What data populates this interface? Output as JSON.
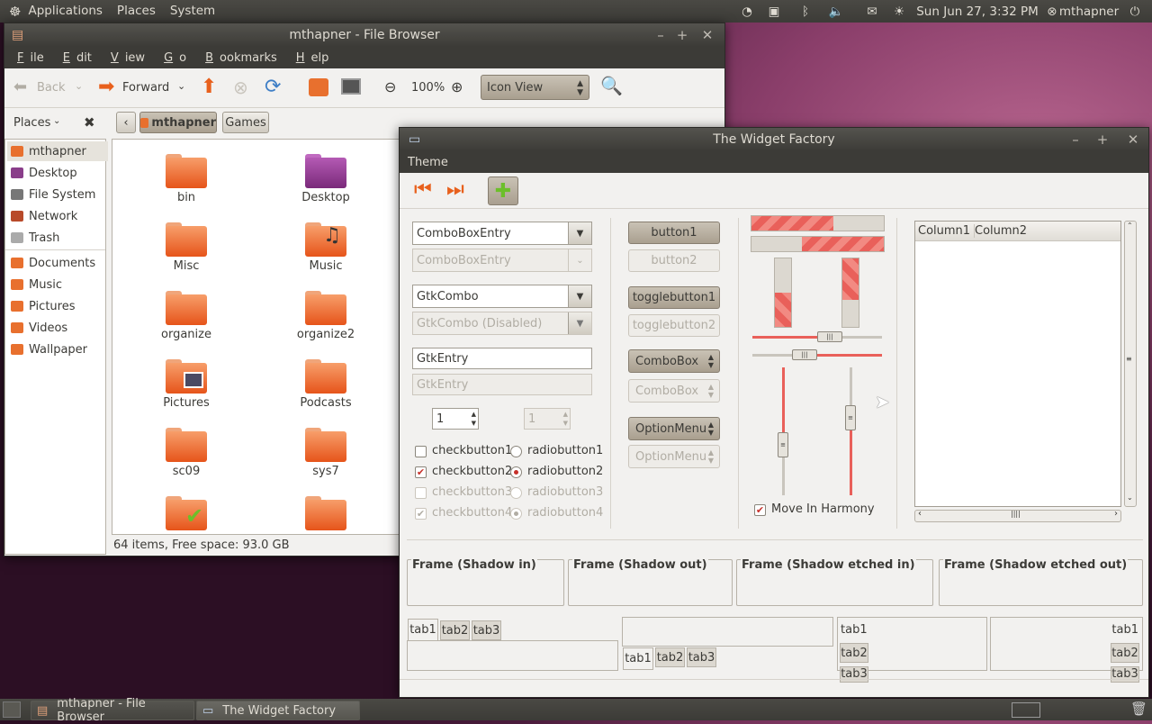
{
  "top_panel": {
    "menus": [
      "Applications",
      "Places",
      "System"
    ],
    "clock": "Sun Jun 27,  3:32 PM",
    "user": "mthapner"
  },
  "file_browser": {
    "title": "mthapner - File Browser",
    "menus": [
      {
        "label": "File",
        "key": "F"
      },
      {
        "label": "Edit",
        "key": "E"
      },
      {
        "label": "View",
        "key": "V"
      },
      {
        "label": "Go",
        "key": "G"
      },
      {
        "label": "Bookmarks",
        "key": "B"
      },
      {
        "label": "Help",
        "key": "H"
      }
    ],
    "toolbar": {
      "back": "Back",
      "forward": "Forward",
      "zoom": "100%",
      "view_mode": "Icon View"
    },
    "places_label": "Places",
    "path": [
      "mthapner",
      "Games"
    ],
    "sidebar": [
      "mthapner",
      "Desktop",
      "File System",
      "Network",
      "Trash",
      "Documents",
      "Music",
      "Pictures",
      "Videos",
      "Wallpaper"
    ],
    "files": [
      "bin",
      "Desktop",
      "Misc",
      "Music",
      "organize",
      "organize2",
      "Pictures",
      "Podcasts",
      "sc09",
      "sys7",
      "",
      ""
    ],
    "status": "64 items, Free space: 93.0 GB"
  },
  "widget_factory": {
    "title": "The Widget Factory",
    "menu": "Theme",
    "combo_entry": "ComboBoxEntry",
    "combo_entry_dis": "ComboBoxEntry",
    "gtk_combo": "GtkCombo",
    "gtk_combo_dis": "GtkCombo (Disabled)",
    "gtk_entry": "GtkEntry",
    "gtk_entry_dis": "GtkEntry",
    "spin1": "1",
    "spin2": "1",
    "checkbuttons": [
      "checkbutton1",
      "checkbutton2",
      "checkbutton3",
      "checkbutton4"
    ],
    "radiobuttons": [
      "radiobutton1",
      "radiobutton2",
      "radiobutton3",
      "radiobutton4"
    ],
    "button1": "button1",
    "button2": "button2",
    "togglebutton1": "togglebutton1",
    "togglebutton2": "togglebutton2",
    "combobox": "ComboBox",
    "combobox_dis": "ComboBox",
    "optionmenu": "OptionMenu",
    "optionmenu_dis": "OptionMenu",
    "harmony": "Move In Harmony",
    "columns": [
      "Column1",
      "Column2"
    ],
    "frames": [
      "Frame (Shadow in)",
      "Frame (Shadow out)",
      "Frame (Shadow etched in)",
      "Frame (Shadow etched out)"
    ],
    "tabs": [
      "tab1",
      "tab2",
      "tab3"
    ]
  },
  "taskbar": {
    "items": [
      "mthapner - File Browser",
      "The Widget Factory"
    ]
  }
}
